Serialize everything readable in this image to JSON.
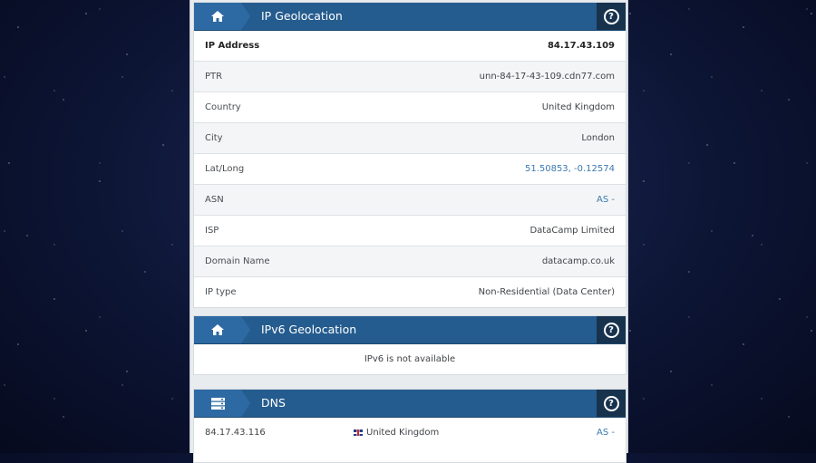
{
  "geo": {
    "title": "IP Geolocation",
    "help_icon": "help-circle-icon",
    "home_icon": "home-icon",
    "rows": [
      {
        "label": "IP Address",
        "value": "84.17.43.109"
      },
      {
        "label": "PTR",
        "value": "unn-84-17-43-109.cdn77.com"
      },
      {
        "label": "Country",
        "value": "United Kingdom"
      },
      {
        "label": "City",
        "value": "London"
      },
      {
        "label": "Lat/Long",
        "value": "51.50853, -0.12574"
      },
      {
        "label": "ASN",
        "value": "AS -"
      },
      {
        "label": "ISP",
        "value": "DataCamp Limited"
      },
      {
        "label": "Domain Name",
        "value": "datacamp.co.uk"
      },
      {
        "label": "IP type",
        "value": "Non-Residential (Data Center)"
      }
    ]
  },
  "ipv6": {
    "title": "IPv6 Geolocation",
    "message": "IPv6 is not available"
  },
  "dns": {
    "title": "DNS",
    "server_icon": "server-icon",
    "rows": [
      {
        "ip": "84.17.43.116",
        "country": "United Kingdom",
        "flag": "uk-flag-icon",
        "asn": "AS -"
      }
    ]
  },
  "colors": {
    "header": "#255c8f",
    "help_button": "#17324d",
    "link": "#3c7ab0"
  }
}
